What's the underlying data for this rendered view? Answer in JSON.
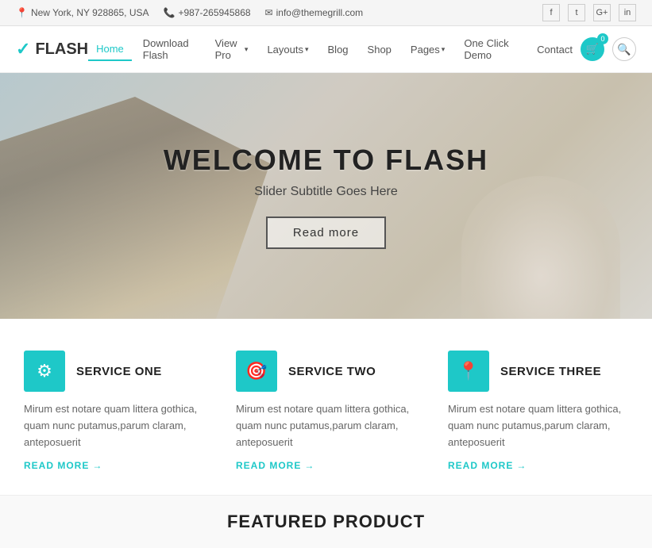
{
  "topbar": {
    "location": "New York, NY 928865, USA",
    "phone": "+987-265945868",
    "email": "info@themegrill.com",
    "location_icon": "📍",
    "phone_icon": "📞",
    "email_icon": "✉"
  },
  "social": {
    "items": [
      {
        "label": "f",
        "name": "facebook"
      },
      {
        "label": "t",
        "name": "twitter"
      },
      {
        "label": "G+",
        "name": "googleplus"
      },
      {
        "label": "in",
        "name": "linkedin"
      }
    ]
  },
  "header": {
    "logo_text": "FLASH",
    "cart_count": "0",
    "nav_items": [
      {
        "label": "Home",
        "active": true,
        "has_arrow": false
      },
      {
        "label": "Download Flash",
        "active": false,
        "has_arrow": false
      },
      {
        "label": "View Pro",
        "active": false,
        "has_arrow": true
      },
      {
        "label": "Layouts",
        "active": false,
        "has_arrow": true
      },
      {
        "label": "Blog",
        "active": false,
        "has_arrow": false
      },
      {
        "label": "Shop",
        "active": false,
        "has_arrow": false
      },
      {
        "label": "Pages",
        "active": false,
        "has_arrow": true
      },
      {
        "label": "One Click Demo",
        "active": false,
        "has_arrow": false
      },
      {
        "label": "Contact",
        "active": false,
        "has_arrow": false
      }
    ]
  },
  "hero": {
    "title": "WELCOME TO FLASH",
    "subtitle": "Slider Subtitle Goes Here",
    "button_label": "Read more"
  },
  "services": [
    {
      "icon": "⚙",
      "title": "SERVICE ONE",
      "desc": "Mirum est notare quam littera gothica, quam nunc putamus,parum claram, anteposuerit",
      "link": "READ MORE"
    },
    {
      "icon": "🎯",
      "title": "SERVICE TWO",
      "desc": "Mirum est notare quam littera gothica, quam nunc putamus,parum claram, anteposuerit",
      "link": "READ MORE"
    },
    {
      "icon": "📍",
      "title": "SERVICE THREE",
      "desc": "Mirum est notare quam littera gothica, quam nunc putamus,parum claram, anteposuerit",
      "link": "READ MORE"
    }
  ],
  "bottom": {
    "title": "FEATURED PRODUCT"
  },
  "colors": {
    "accent": "#1ec8c8",
    "dark": "#222222",
    "light_bg": "#f9f9f9"
  }
}
